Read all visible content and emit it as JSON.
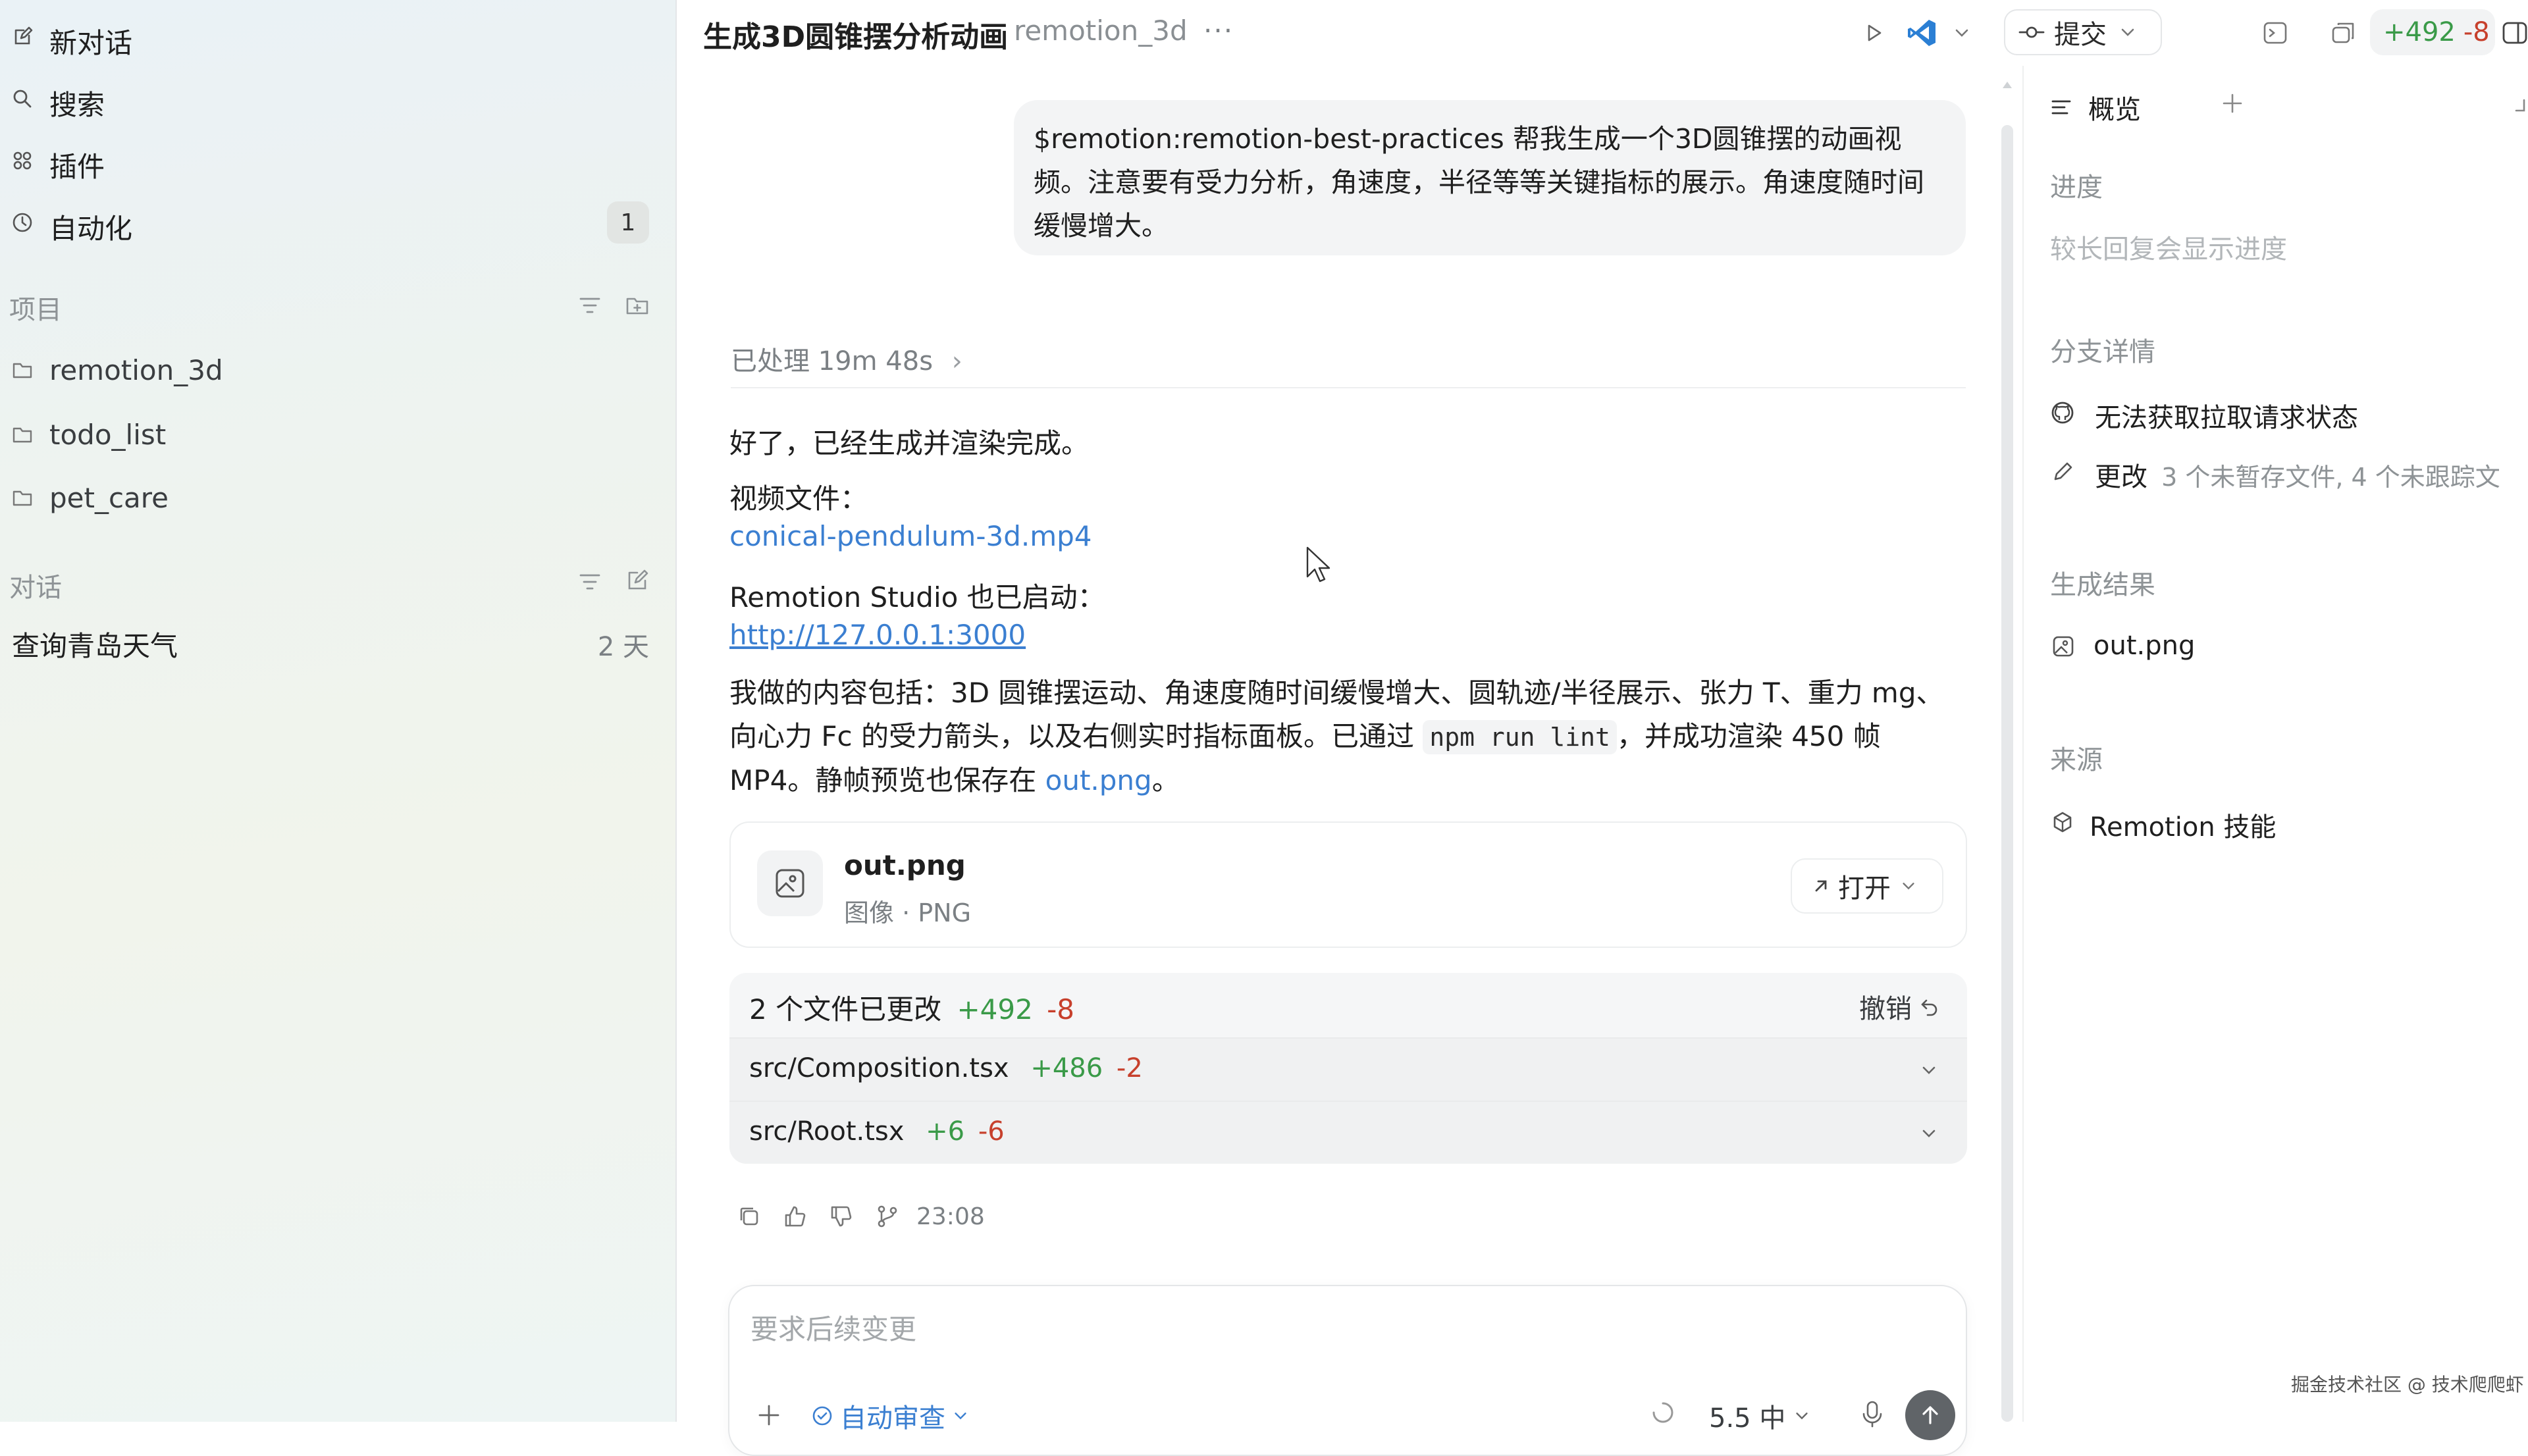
{
  "sidebar": {
    "nav": [
      {
        "label": "新对话",
        "icon": "compose-icon"
      },
      {
        "label": "搜索",
        "icon": "search-icon"
      },
      {
        "label": "插件",
        "icon": "plugins-icon"
      },
      {
        "label": "自动化",
        "icon": "clock-icon",
        "count": "1"
      }
    ],
    "projects_label": "项目",
    "projects": [
      {
        "label": "remotion_3d"
      },
      {
        "label": "todo_list"
      },
      {
        "label": "pet_care"
      }
    ],
    "conversations_label": "对话",
    "conversations": [
      {
        "label": "查询青岛天气",
        "time": "2 天"
      }
    ]
  },
  "header": {
    "title": "生成3D圆锥摆分析动画",
    "project": "remotion_3d",
    "more": "···",
    "commit_label": "提交",
    "diff_plus": "+492",
    "diff_minus": "-8"
  },
  "chat": {
    "user_message": "$remotion:remotion-best-practices  帮我生成一个3D圆锥摆的动画视频。注意要有受力分析，角速度，半径等等关键指标的展示。角速度随时间缓慢增大。",
    "processed": "已处理 19m 48s",
    "reply_done": "好了，已经生成并渲染完成。",
    "video_label": "视频文件：",
    "video_link": "conical-pendulum-3d.mp4",
    "studio_label": "Remotion Studio 也已启动：",
    "studio_link": "http://127.0.0.1:3000",
    "para_part1": "我做的内容包括：3D 圆锥摆运动、角速度随时间缓慢增大、圆轨迹/半径展示、张力 T、重力 mg、向心力 Fc 的受力箭头，以及右侧实时指标面板。已通过 ",
    "para_code": "npm run lint",
    "para_part2": "，并成功渲染 450 帧 MP4。静帧预览也保存在 ",
    "para_link": "out.png",
    "para_end": "。",
    "file_card": {
      "name": "out.png",
      "meta": "图像 · PNG",
      "open_label": "打开"
    },
    "changes": {
      "summary": "2 个文件已更改",
      "plus": "+492",
      "minus": "-8",
      "undo_label": "撤销",
      "files": [
        {
          "path": "src/Composition.tsx",
          "plus": "+486",
          "minus": "-2"
        },
        {
          "path": "src/Root.tsx",
          "plus": "+6",
          "minus": "-6"
        }
      ]
    },
    "message_time": "23:08",
    "composer": {
      "placeholder": "要求后续变更",
      "auto_review": "自动审查",
      "model": "5.5 中"
    }
  },
  "right_panel": {
    "tab_label": "概览",
    "progress_heading": "进度",
    "progress_text": "较长回复会显示进度",
    "branch_heading": "分支详情",
    "pr_status": "无法获取拉取请求状态",
    "changes_label": "更改",
    "changes_detail": "3 个未暂存文件, 4 个未跟踪文",
    "results_heading": "生成结果",
    "result_file": "out.png",
    "source_heading": "来源",
    "source_item": "Remotion 技能"
  },
  "watermark": "掘金技术社区 @ 技术爬爬虾",
  "colors": {
    "accent_blue": "#3b7fd1",
    "diff_green": "#3a9a48",
    "diff_red": "#c7402c",
    "vscode_blue": "#2b7fd4"
  }
}
